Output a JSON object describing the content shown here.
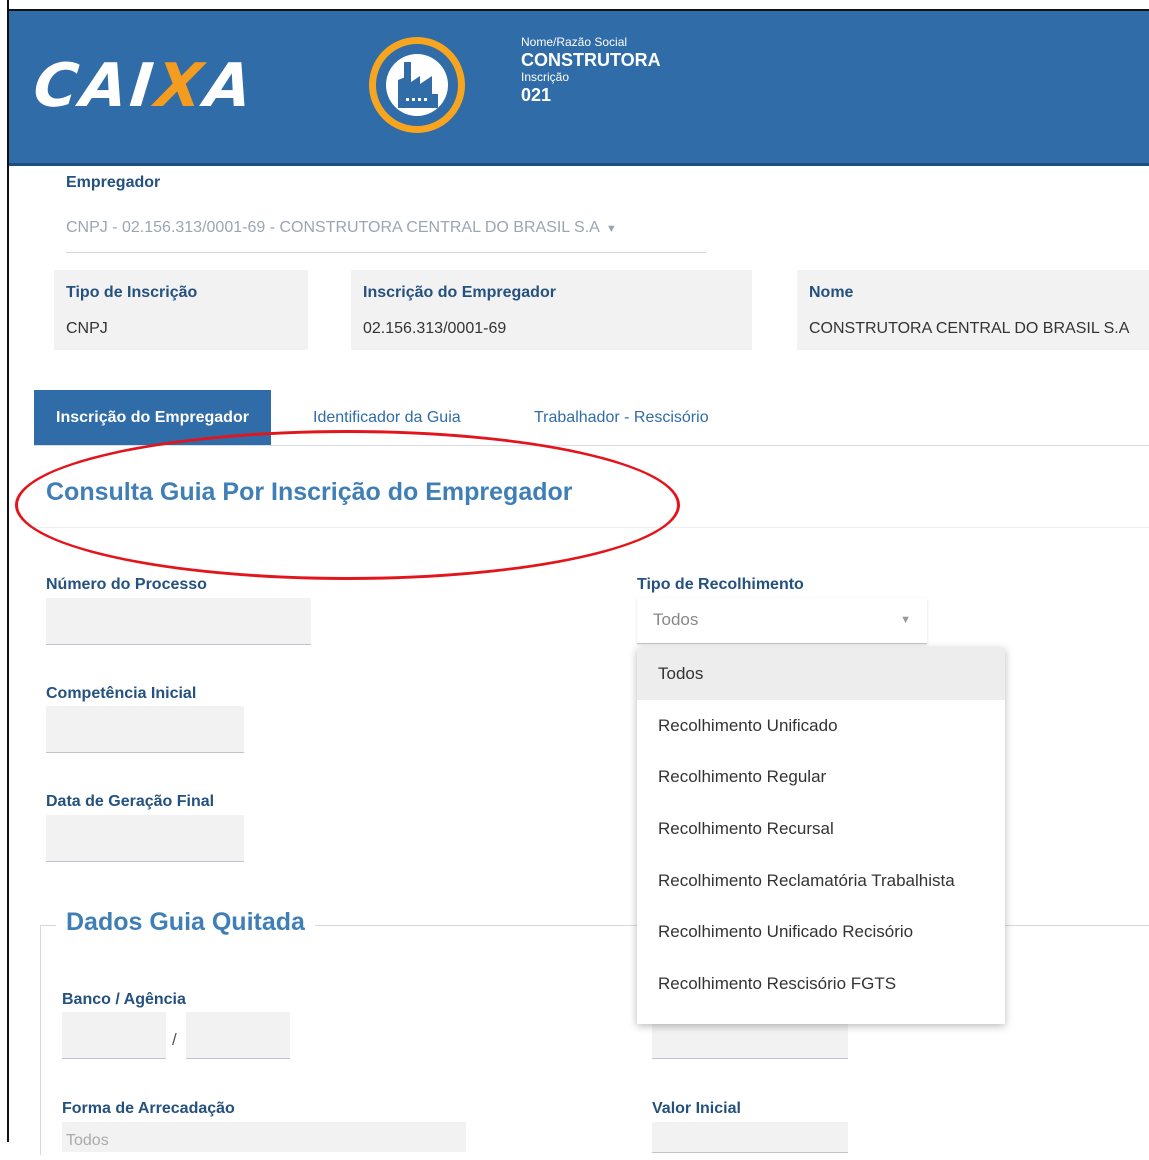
{
  "header": {
    "logo_prefix": "CAI",
    "logo_x": "X",
    "logo_suffix": "A",
    "name_label": "Nome/Razão Social",
    "name_value": "CONSTRUTORA",
    "inscricao_label": "Inscrição",
    "inscricao_value": "021",
    "badge_icon": "factory-icon",
    "bg_color": "#2f6ca8",
    "accent_color": "#f7a51e"
  },
  "empregador": {
    "label": "Empregador",
    "selected": "CNPJ - 02.156.313/0001-69 - CONSTRUTORA CENTRAL DO BRASIL S.A",
    "caret": "▼"
  },
  "info": [
    {
      "label": "Tipo de Inscrição",
      "value": "CNPJ"
    },
    {
      "label": "Inscrição do Empregador",
      "value": "02.156.313/0001-69"
    },
    {
      "label": "Nome",
      "value": "CONSTRUTORA CENTRAL DO BRASIL S.A"
    }
  ],
  "tabs": [
    {
      "label": "Inscrição do Empregador",
      "active": true
    },
    {
      "label": "Identificador da Guia",
      "active": false
    },
    {
      "label": "Trabalhador - Rescisório",
      "active": false
    }
  ],
  "page_title": "Consulta Guia Por Inscrição do Empregador",
  "fields": {
    "numero_processo": "Número do Processo",
    "tipo_recolhimento": "Tipo de Recolhimento",
    "competencia_inicial": "Competência Inicial",
    "data_geracao_final": "Data de Geração Final",
    "banco_agencia": "Banco / Agência",
    "separator": "/",
    "forma_arrecadacao": "Forma de Arrecadação",
    "forma_arrecadacao_value": "Todos",
    "valor_inicial": "Valor Inicial"
  },
  "tipo_select": {
    "value": "Todos",
    "caret": "▼",
    "options": [
      "Todos",
      "Recolhimento Unificado",
      "Recolhimento Regular",
      "Recolhimento Recursal",
      "Recolhimento Reclamatória Trabalhista",
      "Recolhimento Unificado Recisório",
      "Recolhimento Rescisório FGTS"
    ]
  },
  "dados_guia": {
    "legend": "Dados Guia Quitada"
  },
  "annotation_color": "#e3151c"
}
